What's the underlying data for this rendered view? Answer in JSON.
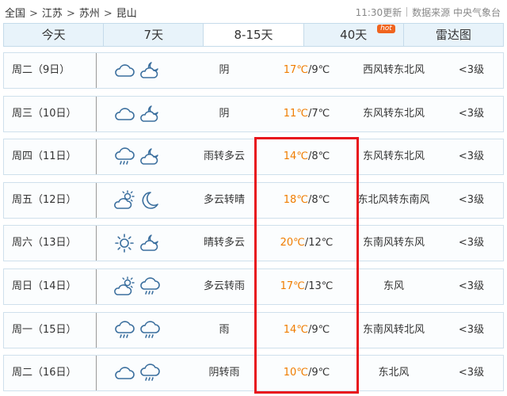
{
  "breadcrumb": {
    "items": [
      "全国",
      "江苏",
      "苏州",
      "昆山"
    ],
    "separator": ">"
  },
  "source": {
    "updated": "11:30更新",
    "label": "数据来源 中央气象台"
  },
  "tabs": [
    {
      "label": "今天",
      "active": false
    },
    {
      "label": "7天",
      "active": false
    },
    {
      "label": "8-15天",
      "active": true
    },
    {
      "label": "40天",
      "active": false,
      "badge": "hot"
    },
    {
      "label": "雷达图",
      "active": false
    }
  ],
  "forecast": [
    {
      "day": "周二（9日）",
      "icon_day": "cloud-icon",
      "icon_night": "cloud-moon-icon",
      "condition": "阴",
      "high": "17℃",
      "low": "9℃",
      "wind": "西风转东北风",
      "level": "<3级"
    },
    {
      "day": "周三（10日）",
      "icon_day": "cloud-icon",
      "icon_night": "cloud-moon-icon",
      "condition": "阴",
      "high": "11℃",
      "low": "7℃",
      "wind": "东风转东北风",
      "level": "<3级"
    },
    {
      "day": "周四（11日）",
      "icon_day": "rain-cloud-icon",
      "icon_night": "cloud-moon-icon",
      "condition": "雨转多云",
      "high": "14℃",
      "low": "8℃",
      "wind": "东风转东北风",
      "level": "<3级"
    },
    {
      "day": "周五（12日）",
      "icon_day": "sun-cloud-icon",
      "icon_night": "moon-icon",
      "condition": "多云转晴",
      "high": "18℃",
      "low": "8℃",
      "wind": "东北风转东南风",
      "level": "<3级"
    },
    {
      "day": "周六（13日）",
      "icon_day": "sun-icon",
      "icon_night": "cloud-moon-icon",
      "condition": "晴转多云",
      "high": "20℃",
      "low": "12℃",
      "wind": "东南风转东风",
      "level": "<3级"
    },
    {
      "day": "周日（14日）",
      "icon_day": "sun-cloud-icon",
      "icon_night": "rain-cloud-icon",
      "condition": "多云转雨",
      "high": "17℃",
      "low": "13℃",
      "wind": "东风",
      "level": "<3级"
    },
    {
      "day": "周一（15日）",
      "icon_day": "rain-cloud-icon",
      "icon_night": "rain-cloud-icon",
      "condition": "雨",
      "high": "14℃",
      "low": "9℃",
      "wind": "东南风转北风",
      "level": "<3级"
    },
    {
      "day": "周二（16日）",
      "icon_day": "cloud-icon",
      "icon_night": "rain-cloud-icon",
      "condition": "阴转雨",
      "high": "10℃",
      "low": "9℃",
      "wind": "东北风",
      "level": "<3级"
    }
  ],
  "colors": {
    "high_temp": "#f07d00",
    "highlight_box": "#e8141c",
    "icon_stroke": "#3b6f9e",
    "tab_bg": "#e8f3fa",
    "hot_badge": "#f0641e"
  }
}
